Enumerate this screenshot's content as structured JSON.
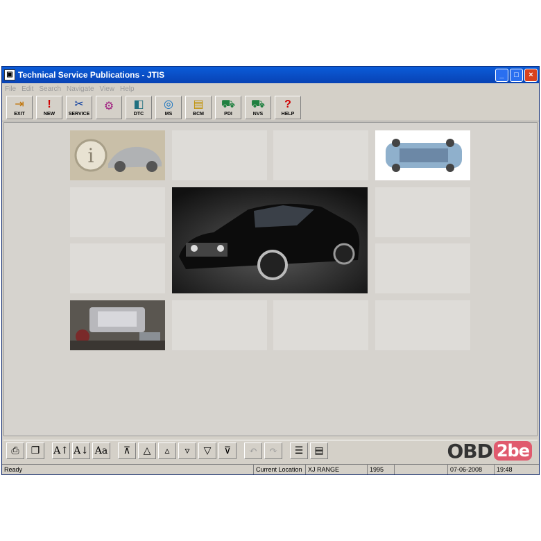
{
  "window": {
    "title": "Technical Service Publications - JTIS",
    "app_icon": "jtis-app-icon"
  },
  "controls": {
    "minimize": "_",
    "maximize": "□",
    "close": "×"
  },
  "menu": [
    "File",
    "Edit",
    "Search",
    "Navigate",
    "View",
    "Help"
  ],
  "toolbar": [
    {
      "label": "EXIT",
      "icon": "exit-icon",
      "glyph": "⇥"
    },
    {
      "label": "NEW",
      "icon": "new-icon",
      "glyph": "!"
    },
    {
      "label": "SERVICE",
      "icon": "service-icon",
      "glyph": "✂"
    },
    {
      "label": "",
      "icon": "diagram-icon",
      "glyph": "⚙"
    },
    {
      "label": "DTC",
      "icon": "dtc-icon",
      "glyph": "◧"
    },
    {
      "label": "MS",
      "icon": "ms-icon",
      "glyph": "◎"
    },
    {
      "label": "BCM",
      "icon": "bcm-icon",
      "glyph": "▤"
    },
    {
      "label": "PDI",
      "icon": "pdi-icon",
      "glyph": "⛟"
    },
    {
      "label": "NVS",
      "icon": "nvs-icon",
      "glyph": "⛟"
    },
    {
      "label": "HELP",
      "icon": "help-icon",
      "glyph": "?"
    }
  ],
  "bottom_toolbar": [
    {
      "name": "print",
      "glyph": "⎙"
    },
    {
      "name": "copy",
      "glyph": "❐"
    },
    {
      "name": "font-larger",
      "glyph": "A↑"
    },
    {
      "name": "font-smaller",
      "glyph": "A↓"
    },
    {
      "name": "font-style",
      "glyph": "Aa"
    },
    {
      "name": "first-page",
      "glyph": "⊼"
    },
    {
      "name": "previous-page",
      "glyph": "△"
    },
    {
      "name": "previous-small",
      "glyph": "▵"
    },
    {
      "name": "next-small",
      "glyph": "▿"
    },
    {
      "name": "next-page",
      "glyph": "▽"
    },
    {
      "name": "last-page",
      "glyph": "⊽"
    },
    {
      "name": "back",
      "glyph": "↶"
    },
    {
      "name": "forward",
      "glyph": "↷"
    },
    {
      "name": "contents",
      "glyph": "☰"
    },
    {
      "name": "document",
      "glyph": "▤"
    }
  ],
  "logo": {
    "text": "OBD",
    "badge": "2be"
  },
  "status": {
    "ready": "Ready",
    "location_label": "Current Location",
    "location_value": "XJ RANGE",
    "year": "1995",
    "date": "07-06-2008",
    "time": "19:48"
  }
}
